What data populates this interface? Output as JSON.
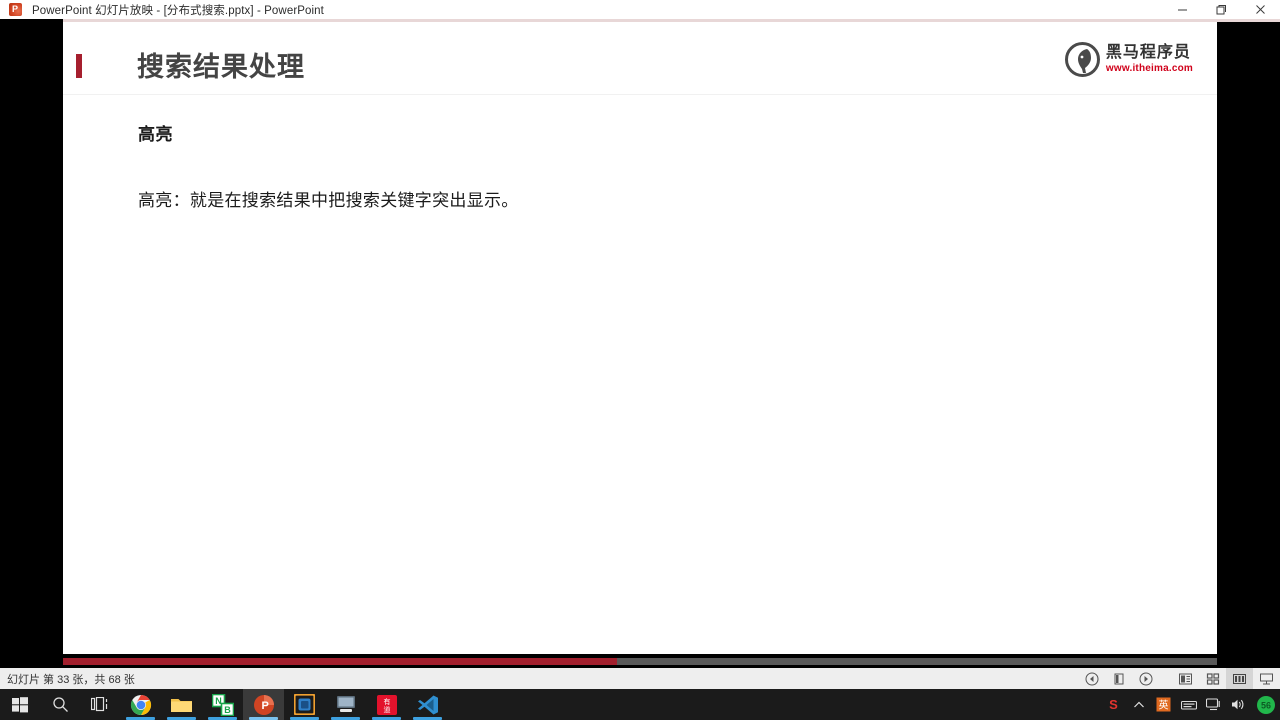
{
  "window": {
    "app_icon": "powerpoint-icon",
    "title": "PowerPoint 幻灯片放映 - [分布式搜索.pptx] - PowerPoint",
    "minimize_label": "─",
    "restore_label": "❐",
    "close_label": "✕",
    "accent_color": "#e8d7d7"
  },
  "slide": {
    "title": "搜索结果处理",
    "title_accent_color": "#a61f2e",
    "heading": "高亮",
    "body": "高亮：就是在搜索结果中把搜索关键字突出显示。",
    "logo": {
      "name_cn": "黑马程序员",
      "url": "www.itheima.com",
      "url_color": "#d0021b",
      "mark": "horse-head-circle-icon"
    }
  },
  "progress": {
    "percent": 48,
    "fill_color": "#a21f2d",
    "track_color": "#595959"
  },
  "status_bar": {
    "slide_counter": "幻灯片 第 33 张，共 68 张",
    "controls": [
      {
        "name": "previous-slide-button",
        "icon": "circle-left-arrow-icon"
      },
      {
        "name": "pause-button",
        "icon": "pause-icon"
      },
      {
        "name": "next-slide-button",
        "icon": "circle-right-arrow-icon"
      },
      {
        "name": "normal-view-button",
        "icon": "normal-view-icon"
      },
      {
        "name": "slide-sorter-button",
        "icon": "grid-view-icon"
      },
      {
        "name": "reading-view-button",
        "icon": "reading-view-icon"
      },
      {
        "name": "slide-show-button",
        "icon": "projector-screen-icon"
      }
    ]
  },
  "taskbar": {
    "items": [
      {
        "name": "start-button",
        "icon": "windows-logo-icon"
      },
      {
        "name": "search-button",
        "icon": "search-icon"
      },
      {
        "name": "task-view-button",
        "icon": "task-view-icon"
      },
      {
        "name": "taskbar-chrome",
        "icon": "chrome-icon"
      },
      {
        "name": "taskbar-file-explorer",
        "icon": "folder-icon"
      },
      {
        "name": "taskbar-onenote",
        "icon": "onenote-icon"
      },
      {
        "name": "taskbar-powerpoint",
        "icon": "powerpoint-icon"
      },
      {
        "name": "taskbar-vmware",
        "icon": "vmware-icon"
      },
      {
        "name": "taskbar-remote-desktop",
        "icon": "remote-desktop-icon"
      },
      {
        "name": "taskbar-youdao",
        "icon": "dictionary-icon",
        "label": "有道"
      },
      {
        "name": "taskbar-vscode",
        "icon": "vscode-icon"
      }
    ],
    "tray": [
      {
        "name": "tray-sogou-ime",
        "icon": "sogou-ime-icon",
        "label": "S"
      },
      {
        "name": "tray-show-hidden-icons",
        "icon": "chevron-up-icon"
      },
      {
        "name": "tray-ime-status",
        "icon": "ime-icon"
      },
      {
        "name": "tray-keyboard",
        "icon": "keyboard-icon"
      },
      {
        "name": "tray-network",
        "icon": "network-icon"
      },
      {
        "name": "tray-volume",
        "icon": "volume-icon"
      },
      {
        "name": "tray-greenshot",
        "icon": "green-badge-icon",
        "label": "56"
      }
    ]
  }
}
